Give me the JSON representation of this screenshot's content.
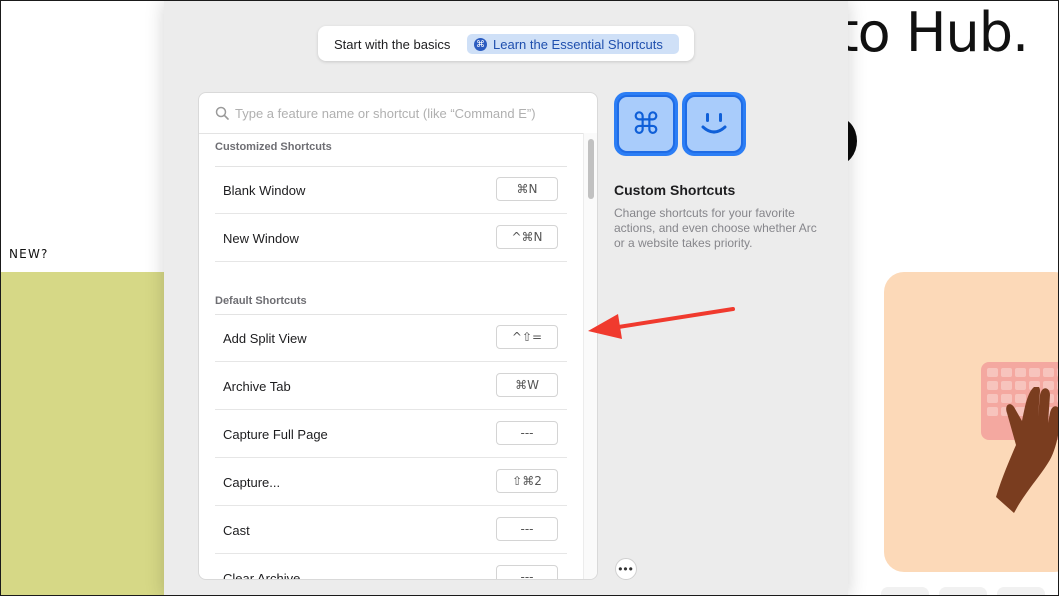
{
  "background": {
    "heading": "-to Hub.",
    "new_label": "NEW?",
    "accent_green": "#d6d886",
    "accent_peach": "#fcd9b8"
  },
  "topbar": {
    "label": "Start with the basics",
    "button_label": "Learn the Essential Shortcuts",
    "button_icon": "command-icon"
  },
  "search": {
    "placeholder": "Type a feature name or shortcut (like “Command E”)",
    "value": ""
  },
  "sections": {
    "customized": {
      "title": "Customized Shortcuts",
      "items": [
        {
          "label": "Blank Window",
          "shortcut": "⌘N"
        },
        {
          "label": "New Window",
          "shortcut": "^⌘N"
        }
      ]
    },
    "default": {
      "title": "Default Shortcuts",
      "items": [
        {
          "label": "Add Split View",
          "shortcut": "^⇧="
        },
        {
          "label": "Archive Tab",
          "shortcut": "⌘W"
        },
        {
          "label": "Capture Full Page",
          "shortcut": "---"
        },
        {
          "label": "Capture...",
          "shortcut": "⇧⌘2"
        },
        {
          "label": "Cast",
          "shortcut": "---"
        },
        {
          "label": "Clear Archive",
          "shortcut": "---"
        }
      ]
    }
  },
  "info": {
    "tiles": [
      {
        "icon": "command-icon",
        "glyph": "⌘"
      },
      {
        "icon": "smiley-icon",
        "glyph": ""
      }
    ],
    "title": "Custom Shortcuts",
    "description": "Change shortcuts for your favorite actions, and even choose whether Arc or a website takes priority."
  },
  "more_button": "•••",
  "annotation": {
    "arrow_color": "#f03a2e",
    "icon": "red-arrow-icon"
  },
  "colors": {
    "accent_blue": "#2c7ef5",
    "button_bg": "#cfe0f7",
    "button_text": "#1f4fae"
  }
}
